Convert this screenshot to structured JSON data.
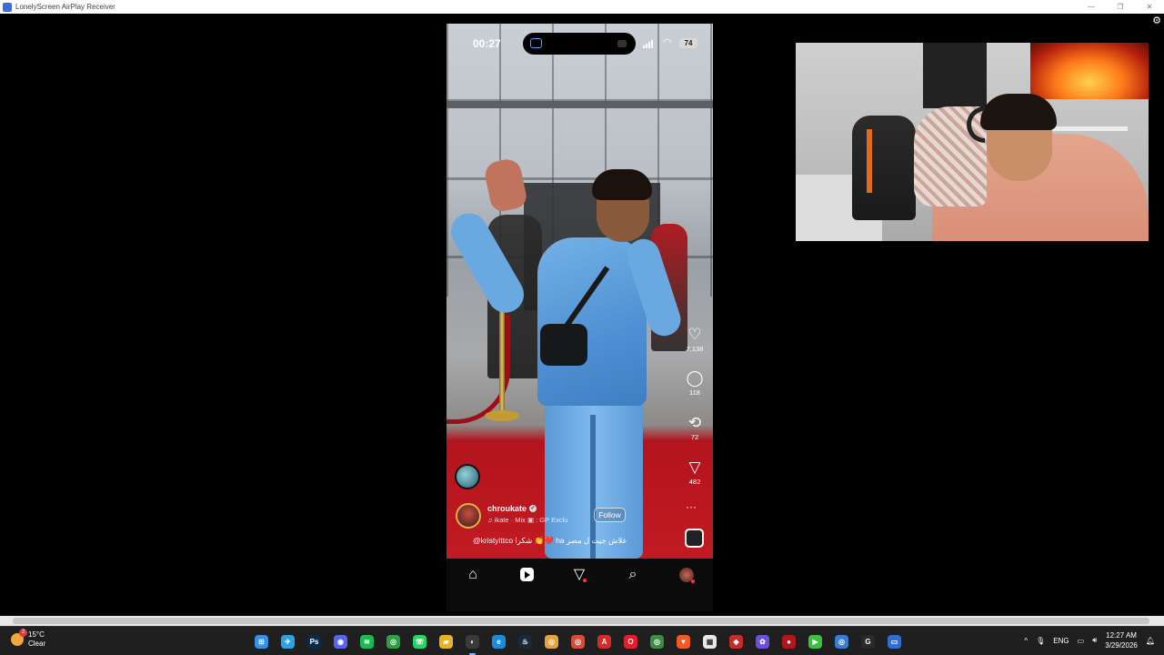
{
  "window": {
    "title": "LonelyScreen AirPlay Receiver",
    "controls": {
      "minimize": "—",
      "restore": "❐",
      "close": "✕"
    },
    "settings_icon": "gear-icon"
  },
  "phone": {
    "status": {
      "time": "00:27",
      "battery": "74"
    },
    "rail": {
      "like_count": "7,138",
      "comment_count": "118",
      "repost_count": "72",
      "share_count": "482"
    },
    "post": {
      "author": "chroukate",
      "music": "♫  ikate · Mix  ▣ : GP Exclu",
      "follow_label": "Follow",
      "caption": "@kristyittco شكرا 👏❤️ ha علاش جيت ل مصر"
    },
    "nav": [
      "home-icon",
      "reels-icon",
      "send-icon",
      "search-icon",
      "profile-icon"
    ]
  },
  "taskbar": {
    "weather": {
      "temp": "15°C",
      "condition": "Clear",
      "badge": "2"
    },
    "apps": [
      {
        "name": "windows-start",
        "color": "#3a8ee6",
        "glyph": "⊞"
      },
      {
        "name": "telegram",
        "color": "#2aa3e0",
        "glyph": "✈"
      },
      {
        "name": "photoshop",
        "color": "#0c2a4a",
        "glyph": "Ps"
      },
      {
        "name": "discord",
        "color": "#5865f2",
        "glyph": "◉"
      },
      {
        "name": "spotify",
        "color": "#1db954",
        "glyph": "≋"
      },
      {
        "name": "chrome",
        "color": "#2f9e44",
        "glyph": "◎"
      },
      {
        "name": "whatsapp",
        "color": "#25d366",
        "glyph": "☏"
      },
      {
        "name": "file-explorer",
        "color": "#e6b422",
        "glyph": "▰"
      },
      {
        "name": "obs",
        "color": "#3a3a3a",
        "glyph": "◐"
      },
      {
        "name": "edge",
        "color": "#1a8cd8",
        "glyph": "e"
      },
      {
        "name": "steam",
        "color": "#1b2838",
        "glyph": "♨"
      },
      {
        "name": "chrome-2",
        "color": "#e8a33d",
        "glyph": "◎"
      },
      {
        "name": "chrome-3",
        "color": "#d84b3b",
        "glyph": "◎"
      },
      {
        "name": "acrobat",
        "color": "#d42b2b",
        "glyph": "A"
      },
      {
        "name": "opera",
        "color": "#e0202f",
        "glyph": "O"
      },
      {
        "name": "chrome-4",
        "color": "#3d8b47",
        "glyph": "◎"
      },
      {
        "name": "brave",
        "color": "#f05a28",
        "glyph": "▼"
      },
      {
        "name": "store",
        "color": "#e8e8e8",
        "glyph": "▦"
      },
      {
        "name": "app-red",
        "color": "#c72c2c",
        "glyph": "◆"
      },
      {
        "name": "app-color",
        "color": "#6b4fe0",
        "glyph": "✿"
      },
      {
        "name": "app-red-2",
        "color": "#b3151d",
        "glyph": "●"
      },
      {
        "name": "app-play",
        "color": "#3fbf3f",
        "glyph": "▶"
      },
      {
        "name": "chrome-5",
        "color": "#3a7bd5",
        "glyph": "◎"
      },
      {
        "name": "logitech",
        "color": "#2a2a2a",
        "glyph": "G"
      },
      {
        "name": "lonelyscreen",
        "color": "#2f6fd1",
        "glyph": "▭"
      }
    ],
    "tray": {
      "chevron": "^",
      "lang": "ENG",
      "time": "12:27 AM",
      "date": "3/29/2026"
    }
  }
}
